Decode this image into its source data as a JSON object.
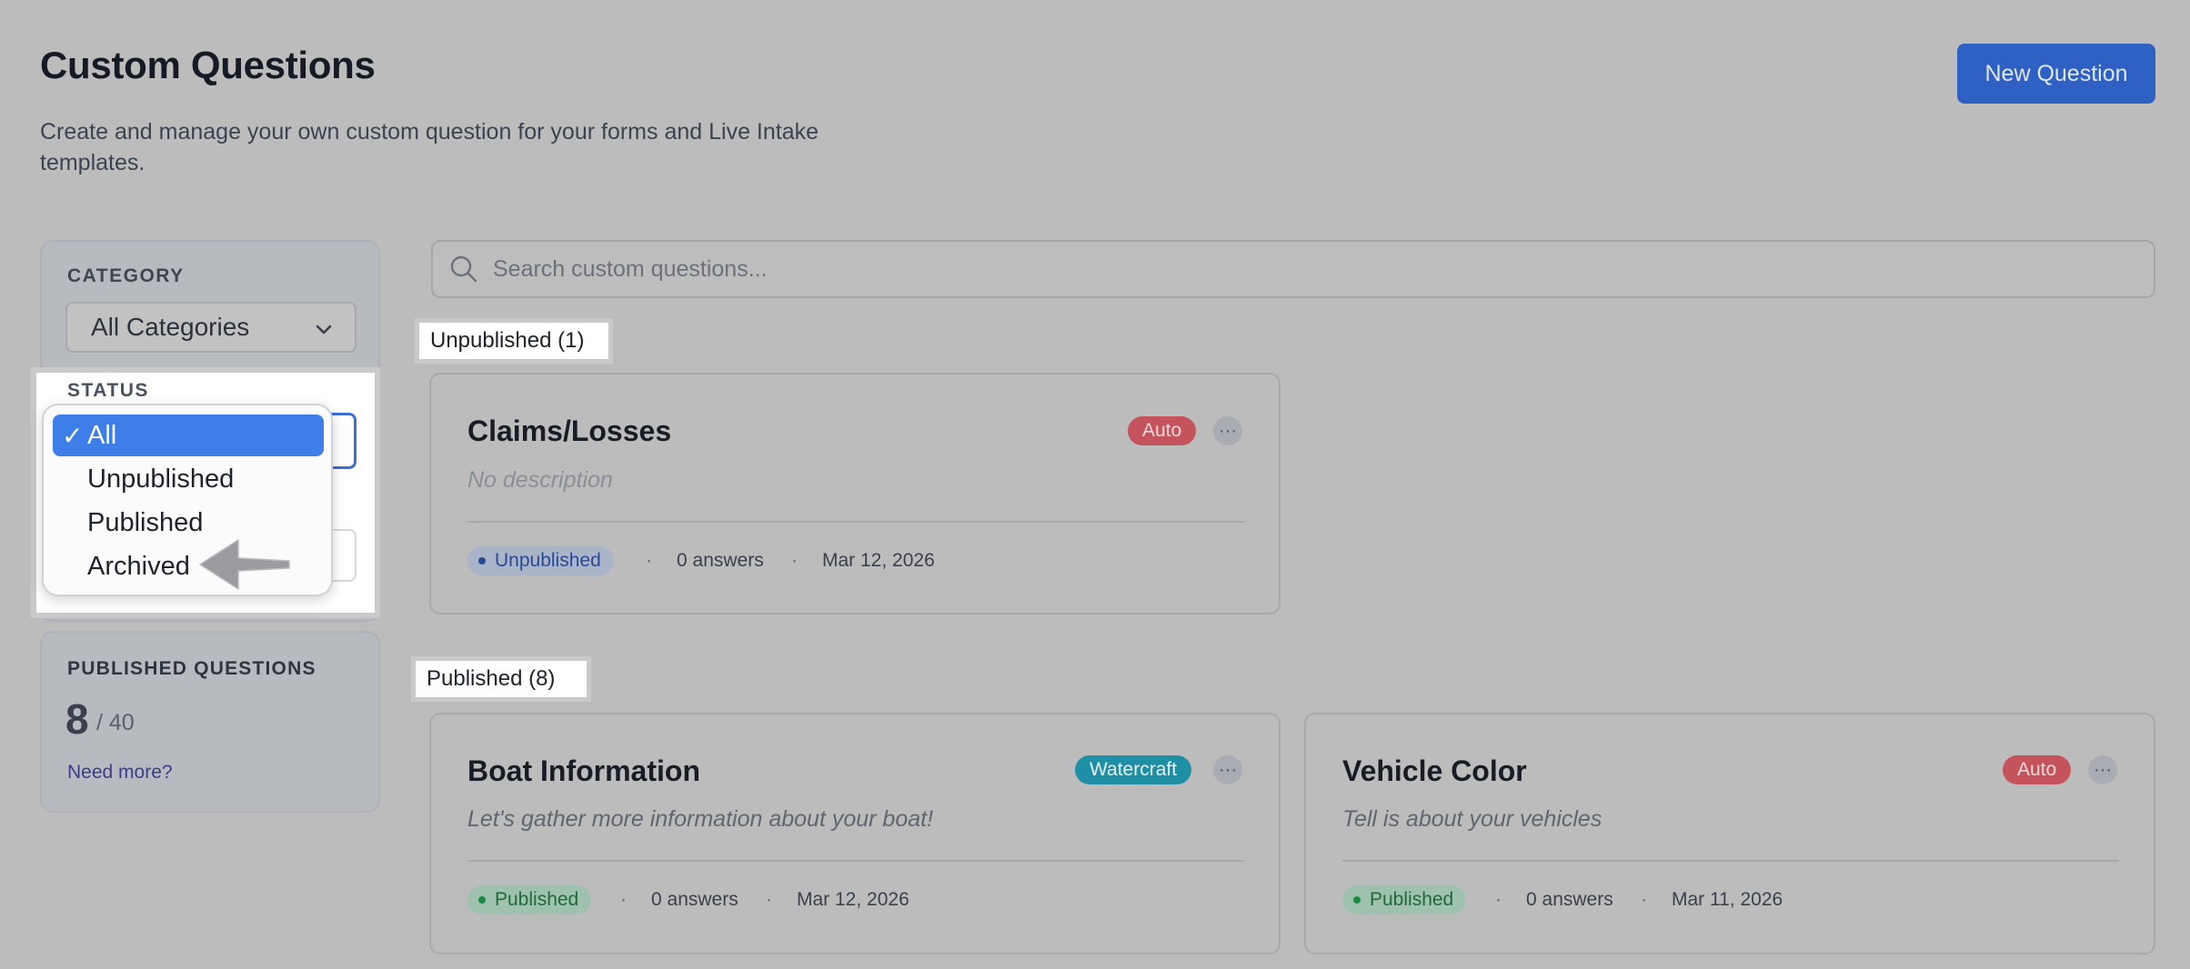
{
  "header": {
    "title": "Custom Questions",
    "subtitle": "Create and manage your own custom question for your forms and Live Intake templates.",
    "new_question_label": "New Question"
  },
  "filters": {
    "category_label": "CATEGORY",
    "category_value": "All Categories",
    "status_label": "STATUS",
    "status_options": [
      {
        "label": "All",
        "selected": true
      },
      {
        "label": "Unpublished",
        "selected": false
      },
      {
        "label": "Published",
        "selected": false
      },
      {
        "label": "Archived",
        "selected": false
      }
    ],
    "check_glyph": "✓"
  },
  "quota": {
    "label": "PUBLISHED QUESTIONS",
    "count": "8",
    "limit": "/ 40",
    "need_more": "Need more?"
  },
  "search": {
    "placeholder": "Search custom questions..."
  },
  "sections": {
    "unpublished": {
      "label": "Unpublished (1)",
      "cards": [
        {
          "title": "Claims/Losses",
          "description": "No description",
          "badge": "Auto",
          "status": "Unpublished",
          "answers": "0 answers",
          "date": "Mar 12, 2026"
        }
      ]
    },
    "published": {
      "label": "Published (8)",
      "cards": [
        {
          "title": "Boat Information",
          "description": "Let's gather more information about your boat!",
          "badge": "Watercraft",
          "status": "Published",
          "answers": "0 answers",
          "date": "Mar 12, 2026"
        },
        {
          "title": "Vehicle Color",
          "description": "Tell is about your vehicles",
          "badge": "Auto",
          "status": "Published",
          "answers": "0 answers",
          "date": "Mar 11, 2026"
        }
      ]
    }
  },
  "ui": {
    "more_glyph": "···",
    "meta_separator": "·"
  },
  "colors": {
    "primary": "#2f60c4",
    "dropdown_selected": "#3d7ee8",
    "badge_auto": "#c4535b",
    "badge_watercraft": "#1f8fa6",
    "status_published": "#1f8a43",
    "status_unpublished": "#2a4a94"
  },
  "icons": {
    "search": "search-icon",
    "chevron": "chevron-down-icon",
    "more": "more-horizontal-icon",
    "check": "check-icon",
    "pointer": "arrow-left-icon"
  }
}
